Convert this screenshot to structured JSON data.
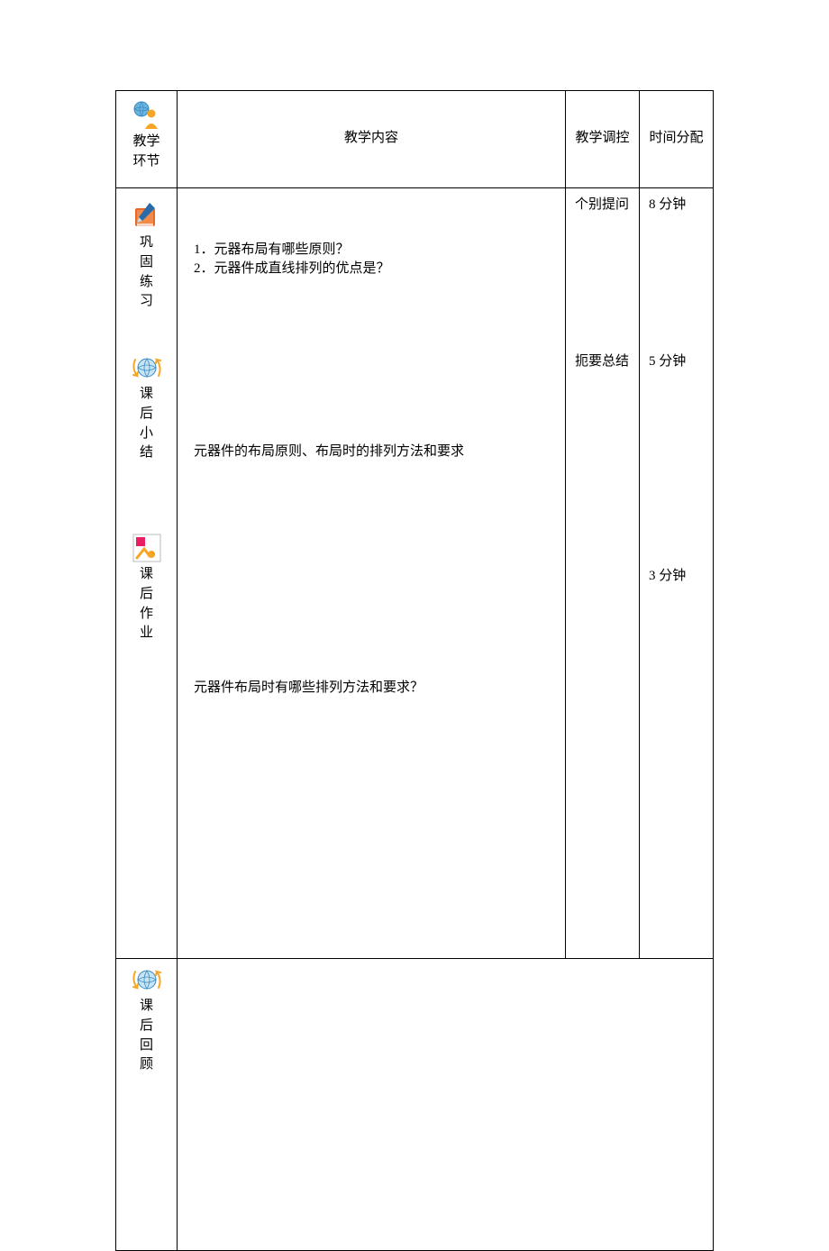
{
  "header": {
    "stage": "教学环节",
    "content": "教学内容",
    "control": "教学调控",
    "time": "时间分配"
  },
  "sections": {
    "practice": {
      "label_l1": "巩",
      "label_l2": "固",
      "label_l3": "练",
      "label_l4": "习",
      "content_line1": "1．元器布局有哪些原则？",
      "content_line2": "2．元器件成直线排列的优点是？",
      "control": "个别提问",
      "time": "8 分钟"
    },
    "summary": {
      "label_l1": "课",
      "label_l2": "后",
      "label_l3": "小",
      "label_l4": "结",
      "content": "元器件的布局原则、布局时的排列方法和要求",
      "control": "扼要总结",
      "time": "5 分钟"
    },
    "homework": {
      "label_l1": "课",
      "label_l2": "后",
      "label_l3": "作",
      "label_l4": "业",
      "content": "元器件布局时有哪些排列方法和要求？",
      "control": "",
      "time": "3 分钟"
    },
    "review": {
      "label_l1": "课",
      "label_l2": "后",
      "label_l3": "回",
      "label_l4": "顾",
      "content": ""
    }
  }
}
